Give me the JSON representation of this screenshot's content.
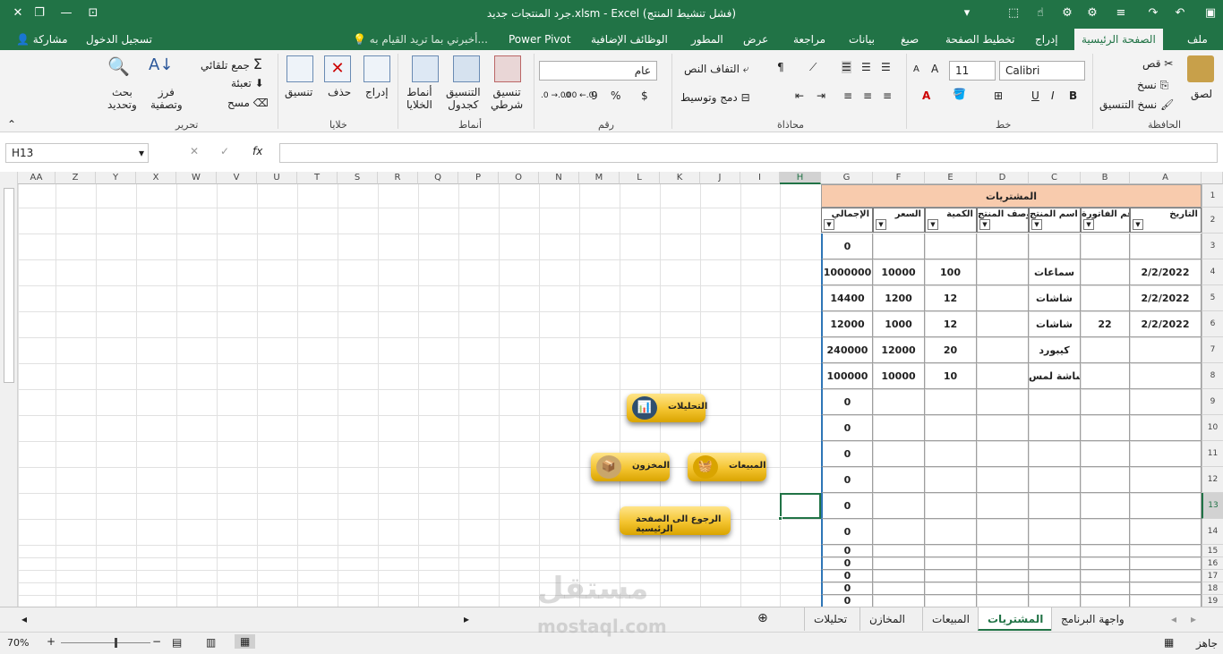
{
  "window": {
    "title": "جرد المنتجات جديد.xlsm - Excel (فشل تنشيط المنتج)"
  },
  "tabs": [
    "ملف",
    "الصفحة الرئيسية",
    "إدراج",
    "تخطيط الصفحة",
    "صيغ",
    "بيانات",
    "مراجعة",
    "عرض",
    "المطور",
    "الوظائف الإضافية",
    "Power Pivot"
  ],
  "active_tab": "الصفحة الرئيسية",
  "tell_me": "أخبرني بما تريد القيام به...",
  "sign_in": "تسجيل الدخول",
  "share": "مشاركة",
  "ribbon": {
    "clipboard": {
      "label": "الحافظة",
      "paste": "لصق",
      "cut": "قص",
      "copy": "نسخ",
      "format_painter": "نسخ التنسيق"
    },
    "font": {
      "label": "خط",
      "name": "Calibri",
      "size": "11",
      "bold": "B",
      "italic": "I",
      "underline": "U"
    },
    "alignment": {
      "label": "محاذاة",
      "wrap": "التفاف النص",
      "merge": "دمج وتوسيط"
    },
    "number": {
      "label": "رقم",
      "format": "عام",
      "percent": "%",
      "currency": "$",
      "comma": "9",
      "inc_dec": ".00 ←.0",
      "dec_dec": ".0 →.00"
    },
    "styles": {
      "label": "أنماط",
      "conditional": "تنسيق\nشرطي",
      "table": "التنسيق\nكجدول",
      "cell_styles": "أنماط\nالخلايا"
    },
    "cells": {
      "label": "خلايا",
      "insert": "إدراج",
      "delete": "حذف",
      "format": "تنسيق"
    },
    "editing": {
      "label": "تحرير",
      "autosum": "جمع تلقائي",
      "fill": "تعبئة",
      "clear": "مسح",
      "sort": "فرز\nوتصفية",
      "find": "بحث\nوتحديد"
    }
  },
  "formula_bar": {
    "name_box": "H13",
    "fx": "fx",
    "cancel": "✕",
    "enter": "✓"
  },
  "columns": [
    "A",
    "B",
    "C",
    "D",
    "E",
    "F",
    "G",
    "H",
    "I",
    "J",
    "K",
    "L",
    "M",
    "N",
    "O",
    "P",
    "Q",
    "R",
    "S",
    "T",
    "U",
    "V",
    "W",
    "X",
    "Y",
    "Z",
    "AA"
  ],
  "rows": [
    "1",
    "2",
    "3",
    "4",
    "5",
    "6",
    "7",
    "8",
    "9",
    "10",
    "11",
    "12",
    "13",
    "14",
    "15",
    "16",
    "17",
    "18",
    "19"
  ],
  "table": {
    "title": "المشتريات",
    "headers": [
      "التاريخ",
      "رقم الفاتورة",
      "اسم المنتج",
      "وصف المنتج",
      "الكمية",
      "السعر",
      "الإجمالي"
    ],
    "rows": [
      [
        "",
        "",
        "",
        "",
        "",
        "",
        "0"
      ],
      [
        "2/2/2022",
        "",
        "سماعات",
        "",
        "100",
        "10000",
        "1000000"
      ],
      [
        "2/2/2022",
        "",
        "شاشات",
        "",
        "12",
        "1200",
        "14400"
      ],
      [
        "2/2/2022",
        "22",
        "شاشات",
        "",
        "12",
        "1000",
        "12000"
      ],
      [
        "",
        "",
        "كيبورد",
        "",
        "20",
        "12000",
        "240000"
      ],
      [
        "",
        "",
        "شاشة لمس",
        "",
        "10",
        "10000",
        "100000"
      ],
      [
        "",
        "",
        "",
        "",
        "",
        "",
        "0"
      ],
      [
        "",
        "",
        "",
        "",
        "",
        "",
        "0"
      ],
      [
        "",
        "",
        "",
        "",
        "",
        "",
        "0"
      ],
      [
        "",
        "",
        "",
        "",
        "",
        "",
        "0"
      ],
      [
        "",
        "",
        "",
        "",
        "",
        "",
        "0"
      ],
      [
        "",
        "",
        "",
        "",
        "",
        "",
        "0"
      ],
      [
        "",
        "",
        "",
        "",
        "",
        "",
        "0"
      ],
      [
        "",
        "",
        "",
        "",
        "",
        "",
        "0"
      ],
      [
        "",
        "",
        "",
        "",
        "",
        "",
        "0"
      ],
      [
        "",
        "",
        "",
        "",
        "",
        "",
        "0"
      ],
      [
        "",
        "",
        "",
        "",
        "",
        "",
        "0"
      ]
    ]
  },
  "buttons": {
    "analytics": "التحليلات",
    "sales": "المبيعات",
    "inventory": "المخزون",
    "home": "الرجوع الى الصفحة الرئيسية"
  },
  "sheets": [
    "واجهة البرنامج",
    "المشتريات",
    "المبيعات",
    "المخازن",
    "تحليلات"
  ],
  "active_sheet": "المشتريات",
  "status": {
    "ready": "جاهز",
    "zoom": "70%"
  },
  "watermark": {
    "ar": "مستقل",
    "en": "mostaql.com"
  },
  "colors": {
    "excel_green": "#217346",
    "title_fill": "#f8cbad",
    "gold": "#f4c430"
  }
}
